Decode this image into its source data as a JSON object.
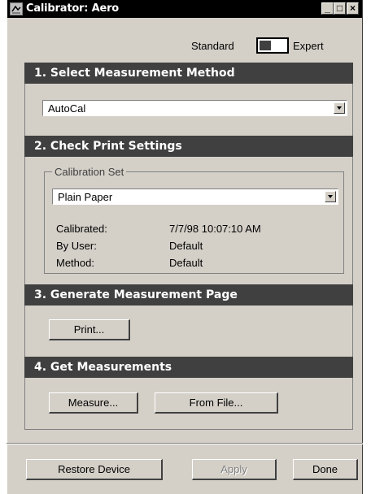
{
  "window": {
    "title": "Calibrator: Aero"
  },
  "titlebar_buttons": {
    "minimize": "_",
    "maximize": "□",
    "close": "×"
  },
  "mode": {
    "left_label": "Standard",
    "right_label": "Expert",
    "selected": "Standard"
  },
  "sections": [
    {
      "title": "1. Select Measurement Method"
    },
    {
      "title": "2. Check Print Settings"
    },
    {
      "title": "3. Generate Measurement Page"
    },
    {
      "title": "4. Get Measurements"
    }
  ],
  "method_select": {
    "value": "AutoCal"
  },
  "calibration_set": {
    "legend": "Calibration Set",
    "value": "Plain Paper",
    "rows": [
      {
        "label": "Calibrated:",
        "value": "7/7/98 10:07:10 AM"
      },
      {
        "label": "By User:",
        "value": "Default"
      },
      {
        "label": "Method:",
        "value": "Default"
      }
    ]
  },
  "buttons": {
    "print": "Print...",
    "measure": "Measure...",
    "from_file": "From File...",
    "restore_device": "Restore Device",
    "apply": "Apply",
    "done": "Done"
  }
}
